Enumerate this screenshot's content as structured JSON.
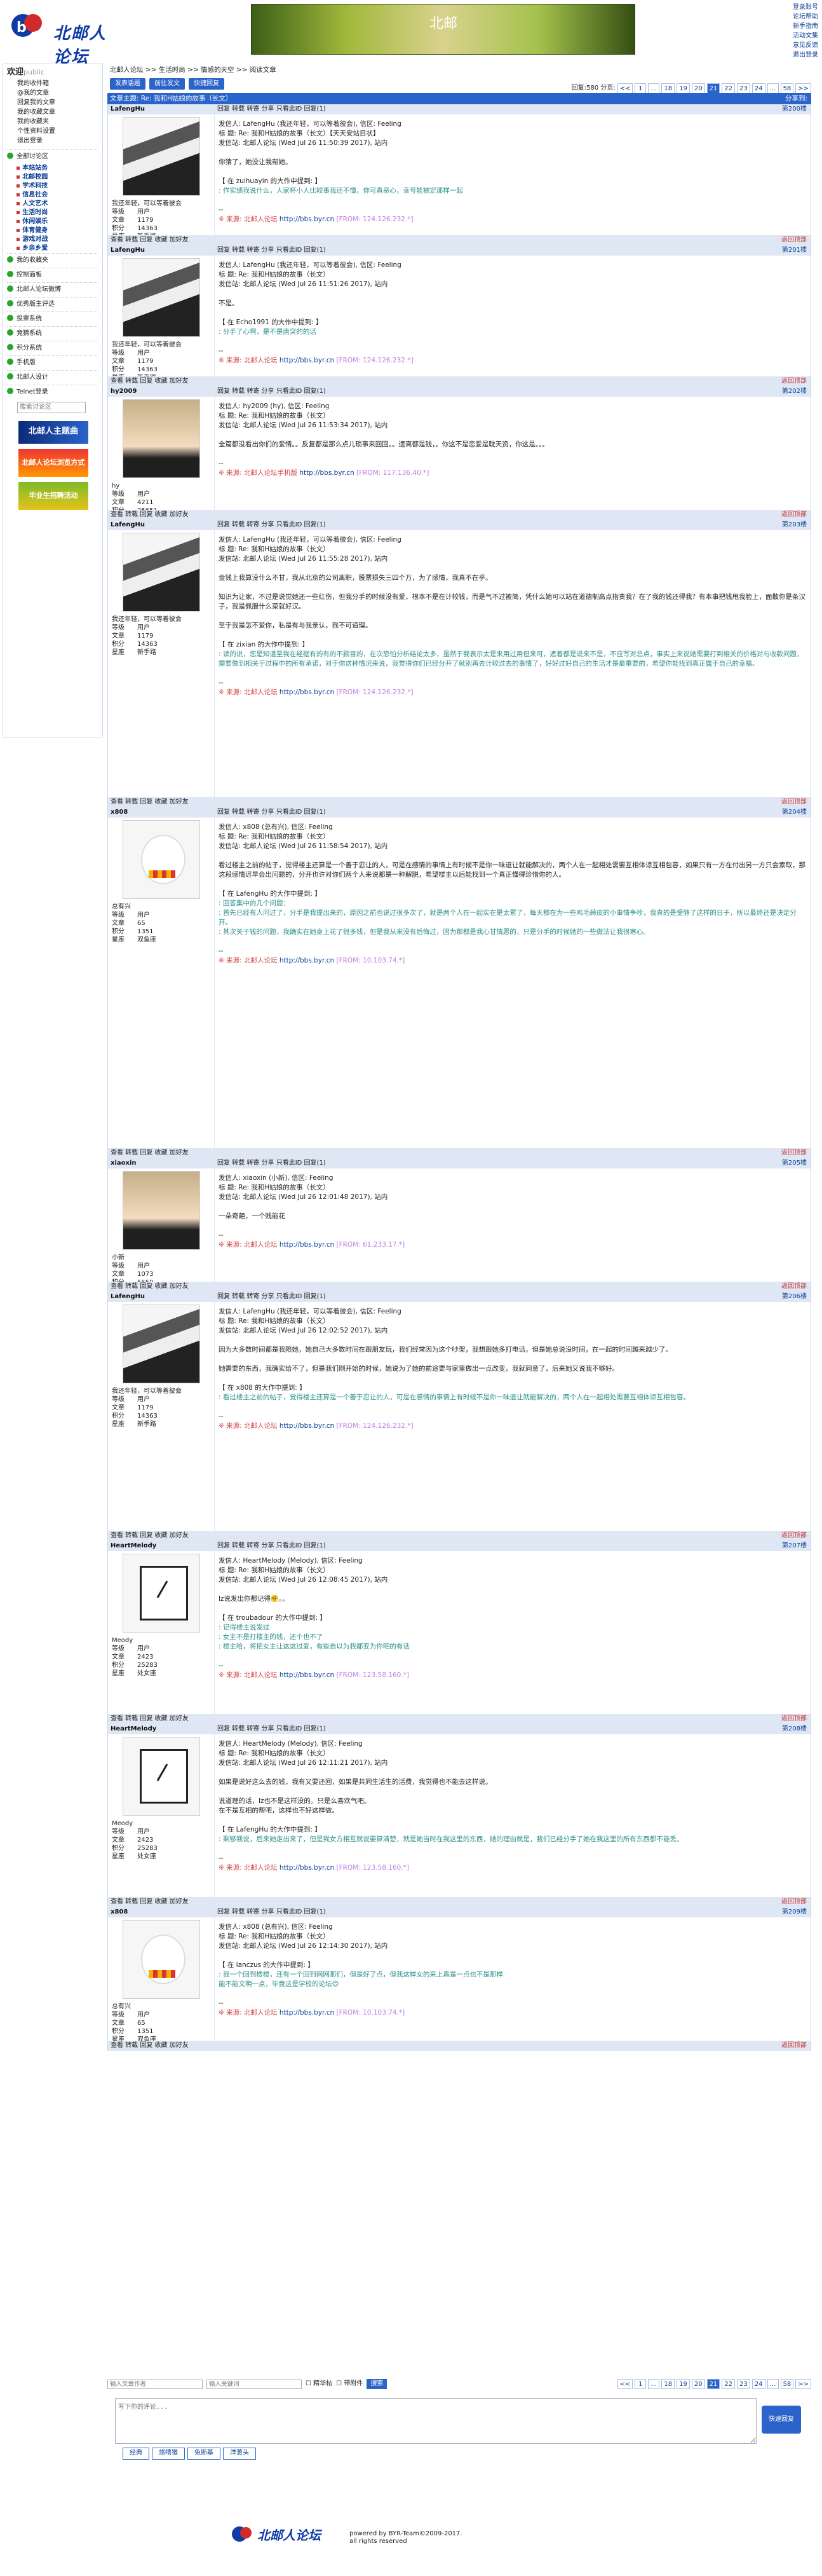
{
  "header": {
    "logo_text": "北邮人论坛",
    "banner_text": "北邮",
    "links": [
      "登录账号",
      "论坛帮助",
      "新手指南",
      "活动文集",
      "意见反馈",
      "退出登录"
    ]
  },
  "sidebar": {
    "welcome": "欢迎",
    "user": "public",
    "links": [
      "我的收件箱",
      "@我的文章",
      "回复我的文章",
      "我的收藏文章",
      "我的收藏夹",
      "个性资料设置",
      "退出登录"
    ],
    "full_section": "全部讨论区",
    "subs": [
      "本站站务",
      "北邮校园",
      "学术科技",
      "信息社会",
      "人文艺术",
      "生活时尚",
      "休闲娱乐",
      "体育健身",
      "游戏对战",
      "乡亲乡爱"
    ],
    "sections": [
      "我的收藏夹",
      "控制面板",
      "北邮人论坛微博",
      "优秀版主评选",
      "投票系统",
      "竞猜系统",
      "积分系统",
      "手机版",
      "北邮人设计",
      "Telnet登录"
    ],
    "search_placeholder": "搜索讨论区",
    "ads": [
      "北邮人主题曲",
      "北邮人论坛浏览方式",
      "毕业生招聘活动"
    ]
  },
  "crumbs": "北邮人论坛 >> 生活时尚 >> 情感的天空 >> 阅读文章",
  "tabs": [
    "发表话题",
    "前往发文",
    "快捷回复"
  ],
  "topbar": {
    "count_label": "回复:580",
    "page_label": "分页:",
    "pages": [
      "<<",
      "1",
      "...",
      "18",
      "19",
      "20",
      "21",
      "22",
      "23",
      "24",
      "...",
      "58",
      ">>"
    ],
    "current": "21"
  },
  "thread_title": "文章主题: Re: 我和H姑娘的故事（长文）",
  "thread_right": "分享到:",
  "ops": "回复  转载  转寄  分享  只看此ID  回复(1)",
  "foot": "查看  转载  回复  收藏  加好友",
  "top_label": "返回顶部",
  "posts": [
    {
      "no": "第200楼",
      "user": "LafengHu",
      "av": "av-girl",
      "sig": "我还年轻，可以等着彼会",
      "rank": "用户",
      "posts": "1179",
      "score": "14363",
      "fresh": "新手路",
      "head": "发信人: LafengHu (我还年轻，可以等着彼会), 信区: Feeling\n标 题: Re: 我和H姑娘的故事（长文）【天天安站目状】\n发信站: 北邮人论坛 (Wed Jul 26 11:50:39 2017), 站内",
      "body": "你猜了，她没让我帮她。",
      "qh": "【 在 zuihuayin 的大作中提到: 】",
      "q": ": 作实绩我说什么，人家杯小人比较事我还不懂，你可真恶心，幸号能被定那样一起",
      "src": "※ 来源: 北邮人论坛",
      "ip": "[FROM: 124.126.232.*]"
    },
    {
      "no": "第201楼",
      "user": "LafengHu",
      "av": "av-girl",
      "sig": "我还年轻，可以等着彼会",
      "rank": "用户",
      "posts": "1179",
      "score": "14363",
      "fresh": "新手路",
      "head": "发信人: LafengHu (我还年轻，可以等着彼会), 信区: Feeling\n标 题: Re: 我和H姑娘的故事（长文）\n发信站: 北邮人论坛 (Wed Jul 26 11:51:26 2017), 站内",
      "body": "不是。",
      "qh": "【 在 Echo1991 的大作中提到: 】",
      "q": ": 分手了心啊，是不是唐突的的话",
      "src": "※ 来源: 北邮人论坛",
      "ip": "[FROM: 124.126.232.*]"
    },
    {
      "no": "第202楼",
      "user": "hy2009",
      "av": "av-boy",
      "sig": "hy",
      "rank": "用户",
      "posts": "4211",
      "score": "25651",
      "fresh": "未知",
      "head": "发信人: hy2009 (hy), 信区: Feeling\n标 题: Re: 我和H姑娘的故事（长文）\n发信站: 北邮人论坛 (Wed Jul 26 11:53:34 2017), 站内",
      "body": "全篇都没看出你们的爱情。。反复都是那么点儿琐事来回回。。遗离都是钱，。你这不是恋爱是耽天资，你这是。。。",
      "qh": "",
      "q": "",
      "src": "※ 来源: 北邮人论坛手机版",
      "ip": "[FROM: 117.136.40.*]"
    },
    {
      "no": "第203楼",
      "user": "LafengHu",
      "av": "av-girl",
      "sig": "我还年轻，可以等着彼会",
      "rank": "用户",
      "posts": "1179",
      "score": "14363",
      "fresh": "新手路",
      "head": "发信人: LafengHu (我还年轻，可以等着彼会), 信区: Feeling\n标 题: Re: 我和H姑娘的故事（长文）\n发信站: 北邮人论坛 (Wed Jul 26 11:55:28 2017), 站内",
      "body": "金钱上我算没什么不甘，我从北京的公司离职，股票损失三四个万，为了感情，我真不在乎。\n\n知识为让家，不过是说觉她还一些红伤，但我分手的时候没有爱，根本不是在计较钱，而是气不过被简，凭什么她可以站在道德制高点指责我？在了我的钱还得我？有本事把钱甩我脸上，面散你是条汉子，我是佩服什么菜就好汉。\n\n至于我是怎不爱你，私是有与我亲认，我不可道理。",
      "qh": "【 在 zixian 的大作中提到: 】",
      "q": ": 读的说，您是知道至我在经据有的有的不顾目的，在次恐怕分析结论太多，虽然于我表示太是来用过用但来可，遮着都是说来不是，不应写对总点，事实上来说她需要打到相关的价格对与收款问题，需要做到相关于过程中的所有承诺，对于你这种情况来说，我觉得你们已经分开了就别再去计较过去的事情了，好好过好自己的生活才是最重要的，希望你能找到真正属于自己的幸福。",
      "src": "※ 来源: 北邮人论坛",
      "ip": "[FROM: 124.126.232.*]"
    },
    {
      "no": "第204楼",
      "user": "x808",
      "av": "av-bear",
      "sig": "总有兴",
      "rank": "用户",
      "posts": "65",
      "score": "1351",
      "fresh": "双鱼座",
      "head": "发信人: x808 (总有兴), 信区: Feeling\n标 题: Re: 我和H姑娘的故事（长文）\n发信站: 北邮人论坛 (Wed Jul 26 11:58:54 2017), 站内",
      "body": "看过楼主之前的帖子，觉得楼主还算是一个善于忍让的人，可是在感情的事情上有时候不是你一味退让就能解决的，两个人在一起相处需要互相体谅互相包容，如果只有一方在付出另一方只会索取，那这段感情迟早会出问题的，分开也许对你们两个人来说都是一种解脱，希望楼主以后能找到一个真正懂得珍惜你的人。",
      "qh": "【 在 LafengHu 的大作中提到: 】",
      "q": ": 回答集中的几个问题：\n: 首先已经有人问过了，分手是我提出来的，原因之前也说过很多次了，就是两个人在一起实在是太累了，每天都在为一些鸡毛蒜皮的小事情争吵，我真的是受够了这样的日子，所以最终还是决定分开。\n: 其次关于钱的问题，我确实在她身上花了很多钱，但是我从来没有后悔过，因为那都是我心甘情愿的，只是分手的时候她的一些做法让我很寒心。",
      "src": "※ 来源: 北邮人论坛",
      "ip": "[FROM: 10.103.74.*]"
    },
    {
      "no": "第205楼",
      "user": "xiaoxin",
      "av": "av-boy",
      "sig": "小新",
      "rank": "用户",
      "posts": "1073",
      "score": "5659",
      "fresh": "白羊座",
      "head": "发信人: xiaoxin (小新), 信区: Feeling\n标 题: Re: 我和H姑娘的故事（长文）\n发信站: 北邮人论坛 (Wed Jul 26 12:01:48 2017), 站内",
      "body": "一朵奇葩，一个贱能花",
      "qh": "",
      "q": "",
      "src": "※ 来源: 北邮人论坛",
      "ip": "[FROM: 61.233.17.*]"
    },
    {
      "no": "第206楼",
      "user": "LafengHu",
      "av": "av-girl",
      "sig": "我还年轻，可以等着彼会",
      "rank": "用户",
      "posts": "1179",
      "score": "14363",
      "fresh": "新手路",
      "head": "发信人: LafengHu (我还年轻，可以等着彼会), 信区: Feeling\n标 题: Re: 我和H姑娘的故事（长文）\n发信站: 北邮人论坛 (Wed Jul 26 12:02:52 2017), 站内",
      "body": "因为大多数时间都是我陪她，她自己大多数时间在跟朋友玩，我们经常因为这个吵架，我想跟她多打电话，但是她总说没时间，在一起的时间越来越少了。\n\n她需要的东西，我确实给不了，但是我们刚开始的时候，她说为了她的前途要与家里做出一点改变，我就同意了，后来她又说我不够好。",
      "qh": "【 在 x808 的大作中提到: 】",
      "q": ": 看过楼主之前的帖子，觉得楼主还算是一个善于忍让的人，可是在感情的事情上有时候不是你一味退让就能解决的，两个人在一起相处需要互相体谅互相包容。",
      "src": "※ 来源: 北邮人论坛",
      "ip": "[FROM: 124.126.232.*]"
    },
    {
      "no": "第207楼",
      "user": "HeartMelody",
      "av": "av-clock",
      "sig": "Meody",
      "rank": "用户",
      "posts": "2423",
      "score": "25283",
      "fresh": "处女座",
      "head": "发信人: HeartMelody (Melody), 信区: Feeling\n标 题: Re: 我和H姑娘的故事（长文）\n发信站: 北邮人论坛 (Wed Jul 26 12:08:45 2017), 站内",
      "body": "lz说发出你都记得🤗。。",
      "qh": "【 在 troubadour 的大作中提到: 】",
      "q": ": 记得楼主说发过\n: 女主不是打楼主的钱，还个也不了\n: 楼主哈，将把女主让这这过爱，有些自以为我都变为你吧的有话",
      "src": "※ 来源: 北邮人论坛",
      "ip": "[FROM: 123.58.160.*]"
    },
    {
      "no": "第208楼",
      "user": "HeartMelody",
      "av": "av-clock",
      "sig": "Meody",
      "rank": "用户",
      "posts": "2423",
      "score": "25283",
      "fresh": "处女座",
      "head": "发信人: HeartMelody (Melody), 信区: Feeling\n标 题: Re: 我和H姑娘的故事（长文）\n发信站: 北邮人论坛 (Wed Jul 26 12:11:21 2017), 站内",
      "body": "如果是说好这么去的钱，我有又要还回，如果是共同生活生的活费，我觉得也不能去这样说。\n\n说道理的话，lz也不是这样没的。只是么喜欢气吧。\n在不是互相的帮吧，这样也不好这样做。",
      "qh": "【 在 LafengHu 的大作中提到: 】",
      "q": ": 剩够我说，后来她走出来了，但是我女方相互就说要算清楚，就是她当时在我这里的东西，她的理由就是，我们已经分手了她在我这里的所有东西都不能丢。",
      "src": "※ 来源: 北邮人论坛",
      "ip": "[FROM: 123.58.160.*]"
    },
    {
      "no": "第209楼",
      "user": "x808",
      "av": "av-bear",
      "sig": "总有兴",
      "rank": "用户",
      "posts": "65",
      "score": "1351",
      "fresh": "双鱼座",
      "head": "发信人: x808 (总有兴), 信区: Feeling\n标 题: Re: 我和H姑娘的故事（长文）\n发信站: 北邮人论坛 (Wed Jul 26 12:14:30 2017), 站内",
      "body": "",
      "qh": "【 在 lanczus 的大作中提到: 】",
      "q": ": 我一个回到楼楼，还有一个回到网网那们，但是好了点，但我这样女的来上真是一点也不是那样\n能不能文明一点，毕竟这是学校的论坛😊",
      "src": "※ 来源: 北邮人论坛",
      "ip": "[FROM: 10.103.74.*]"
    }
  ],
  "bottom": {
    "search_author": "输入文章作者",
    "search_keyword": "输入关键词",
    "only_gen": "精华帖",
    "only_att": "带附件",
    "search_btn": "搜索",
    "reply_ph": "写下你的评论...",
    "reply_btn": "快速回复",
    "emo_tabs": [
      "经典",
      "悠嘻猴",
      "兔斯基",
      "洋葱头"
    ]
  },
  "footer": {
    "logo": "北邮人论坛",
    "line1": "powered by BYR-Team©2009-2017.",
    "line2": "all rights reserved"
  },
  "colors": {
    "accent": "#2a63c9",
    "quote": "#2b8f8b",
    "source": "#d24444"
  }
}
